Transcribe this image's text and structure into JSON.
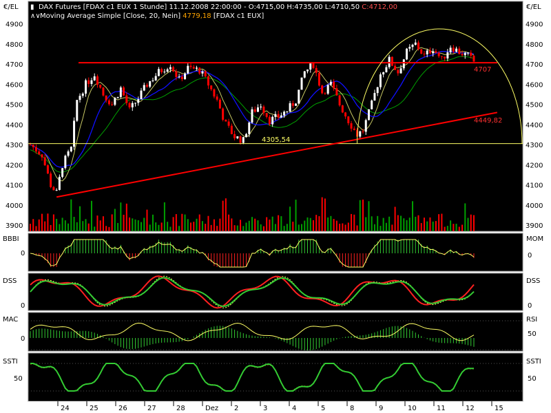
{
  "header": {
    "line1_prefix": "DAX Futures [FDAX c1 EUX  1 Stunde] 11.12.2008 22:00:00 - O:4715,00 H:4735,00 L:4710,50 ",
    "line1_close": "C:4712,00",
    "line2_prefix": "Moving Average Simple [Close, 20, Nein] ",
    "line2_value": "4779,18",
    "line2_suffix": " [FDAX c1 EUX]"
  },
  "units": {
    "left": "€/EL",
    "right": "€/EL"
  },
  "colors": {
    "background": "#000000",
    "frame": "#ffffff",
    "up_candle": "#ffffff",
    "down_candle": "#ff0000",
    "ma_blue": "#1010ff",
    "ma_green": "#00a000",
    "ma_yellow": "#c8c864",
    "trendline": "#ff0000",
    "support": "#ffff66",
    "volume_up": "#00a000",
    "volume_down": "#ff0000",
    "ind_green": "#33cc33",
    "ind_yellow": "#ffff66",
    "ind_red": "#ff2020"
  },
  "annotations": {
    "support_label": "4305,54",
    "resistance_label": "4707",
    "trend_label": "4449,82"
  },
  "panels": {
    "bbbi": {
      "left_label": "BBBI",
      "right_label": "MOM",
      "left_tick": "0",
      "right_tick": "0"
    },
    "dss": {
      "left_label": "DSS",
      "right_label": "DSS",
      "left_tick": "0",
      "right_tick": "0"
    },
    "mac": {
      "left_label": "MAC",
      "right_label": "RSI",
      "left_tick": "0",
      "right_tick": "50"
    },
    "ssti": {
      "left_label": "SSTI",
      "right_label": "SSTI",
      "left_tick": "50",
      "right_tick": "50"
    }
  },
  "chart_data": [
    {
      "type": "candlestick",
      "title": "DAX Futures [FDAX c1 EUX  1 Stunde]",
      "ylim": [
        3870,
        4950
      ],
      "yticks": [
        3900,
        4000,
        4100,
        4200,
        4300,
        4400,
        4500,
        4600,
        4700,
        4800,
        4900
      ],
      "ytick_labels": [
        "3900",
        "4000",
        "4100",
        "4200",
        "4300",
        "4400",
        "4500",
        "4600",
        "4700",
        "4800",
        "4900"
      ],
      "x_axis_labels": [
        "24",
        "25",
        "26",
        "27",
        "28",
        "Dez",
        "2",
        "3",
        "4",
        "5",
        "8",
        "9",
        "10",
        "11",
        "12",
        "15"
      ],
      "price_path": [
        {
          "t": 0,
          "p": 4300
        },
        {
          "t": 4,
          "p": 4250
        },
        {
          "t": 7,
          "p": 4100
        },
        {
          "t": 9,
          "p": 4060
        },
        {
          "t": 11,
          "p": 4200
        },
        {
          "t": 14,
          "p": 4280
        },
        {
          "t": 16,
          "p": 4520
        },
        {
          "t": 19,
          "p": 4600
        },
        {
          "t": 22,
          "p": 4650
        },
        {
          "t": 25,
          "p": 4550
        },
        {
          "t": 28,
          "p": 4500
        },
        {
          "t": 31,
          "p": 4580
        },
        {
          "t": 34,
          "p": 4470
        },
        {
          "t": 37,
          "p": 4530
        },
        {
          "t": 40,
          "p": 4600
        },
        {
          "t": 44,
          "p": 4660
        },
        {
          "t": 48,
          "p": 4700
        },
        {
          "t": 51,
          "p": 4620
        },
        {
          "t": 54,
          "p": 4680
        },
        {
          "t": 58,
          "p": 4670
        },
        {
          "t": 61,
          "p": 4600
        },
        {
          "t": 64,
          "p": 4520
        },
        {
          "t": 67,
          "p": 4400
        },
        {
          "t": 70,
          "p": 4340
        },
        {
          "t": 73,
          "p": 4320
        },
        {
          "t": 76,
          "p": 4460
        },
        {
          "t": 79,
          "p": 4500
        },
        {
          "t": 82,
          "p": 4420
        },
        {
          "t": 85,
          "p": 4440
        },
        {
          "t": 88,
          "p": 4470
        },
        {
          "t": 91,
          "p": 4520
        },
        {
          "t": 94,
          "p": 4660
        },
        {
          "t": 97,
          "p": 4700
        },
        {
          "t": 100,
          "p": 4560
        },
        {
          "t": 103,
          "p": 4600
        },
        {
          "t": 106,
          "p": 4500
        },
        {
          "t": 109,
          "p": 4420
        },
        {
          "t": 112,
          "p": 4350
        },
        {
          "t": 114,
          "p": 4370
        },
        {
          "t": 117,
          "p": 4500
        },
        {
          "t": 120,
          "p": 4650
        },
        {
          "t": 123,
          "p": 4720
        },
        {
          "t": 126,
          "p": 4660
        },
        {
          "t": 129,
          "p": 4760
        },
        {
          "t": 132,
          "p": 4800
        },
        {
          "t": 135,
          "p": 4740
        },
        {
          "t": 138,
          "p": 4780
        },
        {
          "t": 141,
          "p": 4720
        },
        {
          "t": 144,
          "p": 4790
        },
        {
          "t": 147,
          "p": 4760
        },
        {
          "t": 150,
          "p": 4740
        },
        {
          "t": 152,
          "p": 4712
        }
      ],
      "support_level": 4305.54,
      "resistance_level": 4707,
      "trendline": {
        "from": {
          "t": 9,
          "p": 4040
        },
        "to": {
          "t": 160,
          "p": 4460
        }
      }
    }
  ]
}
